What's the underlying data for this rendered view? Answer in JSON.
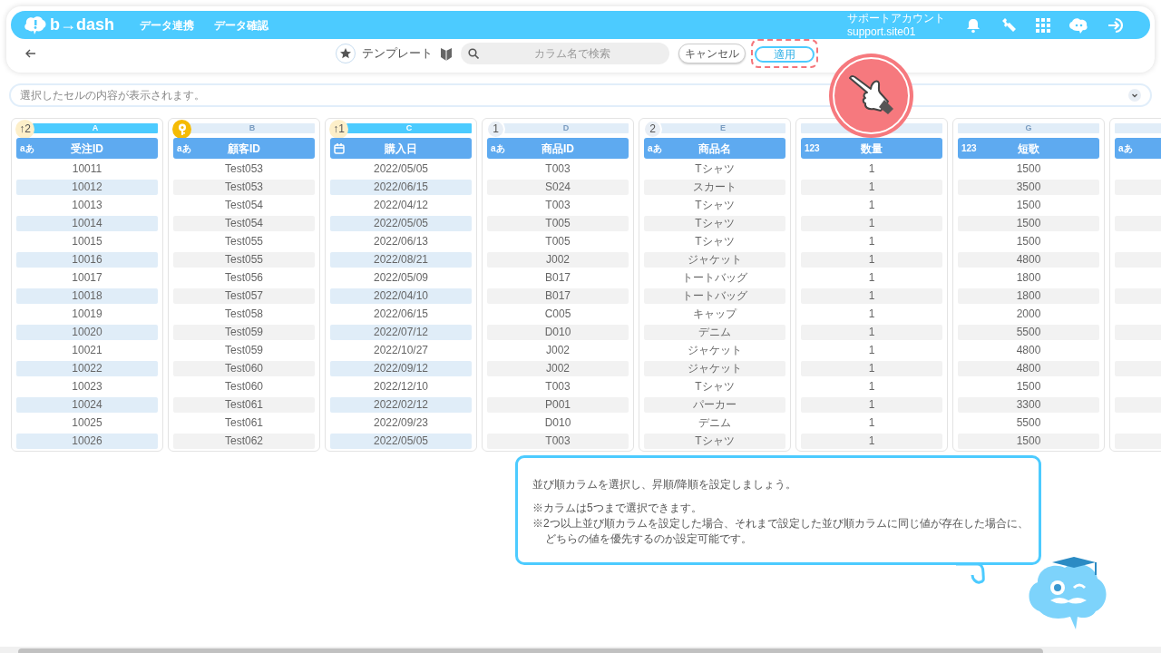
{
  "header": {
    "logo": "b→dash",
    "nav": [
      {
        "label": "データ連携"
      },
      {
        "label": "データ確認"
      }
    ],
    "account_name": "サポートアカウント",
    "account_id": "support.site01"
  },
  "toolbar": {
    "title": "テンプレート",
    "search": {
      "placeholder": "カラム名で検索"
    },
    "cancel": "キャンセル",
    "apply": "適用"
  },
  "cell_preview": {
    "placeholder": "選択したセルの内容が表示されます。"
  },
  "columns": [
    {
      "letter": "A",
      "selected": true,
      "badge": {
        "kind": "sort",
        "label": "↑2"
      },
      "kind": "text",
      "type_label": "aあ",
      "name": "受注ID",
      "values": [
        "10011",
        "10012",
        "10013",
        "10014",
        "10015",
        "10016",
        "10017",
        "10018",
        "10019",
        "10020",
        "10021",
        "10022",
        "10023",
        "10024",
        "10025",
        "10026"
      ]
    },
    {
      "letter": "B",
      "selected": false,
      "badge": {
        "kind": "key"
      },
      "kind": "text",
      "type_label": "aあ",
      "name": "顧客ID",
      "values": [
        "Test053",
        "Test053",
        "Test054",
        "Test054",
        "Test055",
        "Test055",
        "Test056",
        "Test057",
        "Test058",
        "Test059",
        "Test059",
        "Test060",
        "Test060",
        "Test061",
        "Test061",
        "Test062"
      ]
    },
    {
      "letter": "C",
      "selected": true,
      "badge": {
        "kind": "sort",
        "label": "↑1"
      },
      "kind": "date",
      "name": "購入日",
      "values": [
        "2022/05/05",
        "2022/06/15",
        "2022/04/12",
        "2022/05/05",
        "2022/06/13",
        "2022/08/21",
        "2022/05/09",
        "2022/04/10",
        "2022/06/15",
        "2022/07/12",
        "2022/10/27",
        "2022/09/12",
        "2022/12/10",
        "2022/02/12",
        "2022/09/23",
        "2022/05/05"
      ]
    },
    {
      "letter": "D",
      "selected": false,
      "badge": {
        "kind": "order",
        "label": "1"
      },
      "kind": "text",
      "type_label": "aあ",
      "name": "商品ID",
      "values": [
        "T003",
        "S024",
        "T003",
        "T005",
        "T005",
        "J002",
        "B017",
        "B017",
        "C005",
        "D010",
        "J002",
        "J002",
        "T003",
        "P001",
        "D010",
        "T003"
      ]
    },
    {
      "letter": "E",
      "selected": false,
      "badge": {
        "kind": "order",
        "label": "2"
      },
      "kind": "text",
      "type_label": "aあ",
      "name": "商品名",
      "values": [
        "Tシャツ",
        "スカート",
        "Tシャツ",
        "Tシャツ",
        "Tシャツ",
        "ジャケット",
        "トートバッグ",
        "トートバッグ",
        "キャップ",
        "デニム",
        "ジャケット",
        "ジャケット",
        "Tシャツ",
        "パーカー",
        "デニム",
        "Tシャツ"
      ]
    },
    {
      "selected": false,
      "kind": "number",
      "type_label": "123",
      "name": "数量",
      "values": [
        "1",
        "1",
        "1",
        "1",
        "1",
        "1",
        "1",
        "1",
        "1",
        "1",
        "1",
        "1",
        "1",
        "1",
        "1",
        "1"
      ]
    },
    {
      "letter": "G",
      "selected": false,
      "kind": "number",
      "type_label": "123",
      "name": "短歌",
      "values": [
        "1500",
        "3500",
        "1500",
        "1500",
        "1500",
        "4800",
        "1800",
        "1800",
        "2000",
        "5500",
        "4800",
        "4800",
        "1500",
        "3300",
        "5500",
        "1500"
      ]
    },
    {
      "selected": false,
      "kind": "text",
      "type_label": "aあ"
    }
  ],
  "tip": {
    "title": "並び順カラムを選択し、昇順/降順を設定しましょう。",
    "notes": [
      {
        "lines": [
          "※カラムは5つまで選択できます。"
        ]
      },
      {
        "lines": [
          "※2つ以上並び順カラムを設定した場合、それまで設定した並び順カラムに同じ値が存在した場合に、",
          "どちらの値を優先するのか設定可能です。"
        ]
      }
    ]
  }
}
